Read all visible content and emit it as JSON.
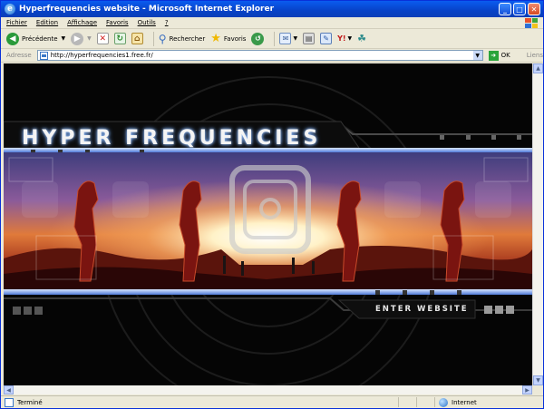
{
  "window": {
    "title": "Hyperfrequencies website - Microsoft Internet Explorer"
  },
  "menu": {
    "items": [
      "Fichier",
      "Edition",
      "Affichage",
      "Favoris",
      "Outils",
      "?"
    ]
  },
  "toolbar": {
    "back_label": "Précédente",
    "search_label": "Rechercher",
    "favorites_label": "Favoris"
  },
  "address": {
    "label": "Adresse",
    "url": "http://hyperfrequencies1.free.fr/",
    "go_label": "OK",
    "links_label": "Liens"
  },
  "page": {
    "logo_text": "HYPER FREQUENCIES",
    "enter_label": "ENTER WEBSITE"
  },
  "status": {
    "text": "Terminé",
    "zone": "Internet"
  },
  "colors": {
    "titlebar": "#0742c7",
    "chrome": "#ece9d8",
    "page_bg": "#050505",
    "banner_sky_top": "#5c5aa0",
    "banner_glow": "#fff4d8",
    "banner_ground": "#7a1e14",
    "accent_blue": "#6fa8ff"
  }
}
